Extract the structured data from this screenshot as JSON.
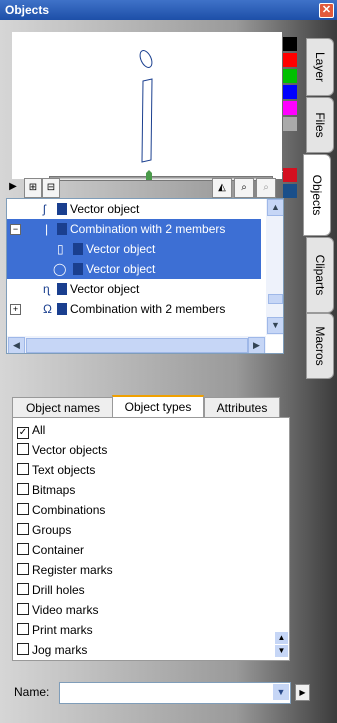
{
  "window": {
    "title": "Objects"
  },
  "side_tabs": [
    {
      "label": "Layer"
    },
    {
      "label": "Files"
    },
    {
      "label": "Objects"
    },
    {
      "label": "Cliparts"
    },
    {
      "label": "Macros"
    }
  ],
  "swatch_colors": [
    "#000000",
    "#ff0000",
    "#00c000",
    "#0000ff",
    "#ff00ff",
    "#aaaaaa"
  ],
  "slider": {
    "minus": "−",
    "plus": "+"
  },
  "tree_items": [
    {
      "label": "Vector object",
      "selected": false
    },
    {
      "label": "Combination with 2 members",
      "selected": true
    },
    {
      "label": "Vector object",
      "selected": true
    },
    {
      "label": "Vector object",
      "selected": true
    },
    {
      "label": "Vector object",
      "selected": false
    },
    {
      "label": "Combination with 2 members",
      "selected": false
    }
  ],
  "tabs": [
    {
      "label": "Object names"
    },
    {
      "label": "Object types"
    },
    {
      "label": "Attributes"
    }
  ],
  "object_types": [
    {
      "label": "All",
      "checked": true
    },
    {
      "label": "Vector objects",
      "checked": false
    },
    {
      "label": "Text objects",
      "checked": false
    },
    {
      "label": "Bitmaps",
      "checked": false
    },
    {
      "label": "Combinations",
      "checked": false
    },
    {
      "label": "Groups",
      "checked": false
    },
    {
      "label": "Container",
      "checked": false
    },
    {
      "label": "Register marks",
      "checked": false
    },
    {
      "label": "Drill holes",
      "checked": false
    },
    {
      "label": "Video marks",
      "checked": false
    },
    {
      "label": "Print marks",
      "checked": false
    },
    {
      "label": "Jog marks",
      "checked": false
    }
  ],
  "name_field": {
    "label": "Name:",
    "value": ""
  }
}
